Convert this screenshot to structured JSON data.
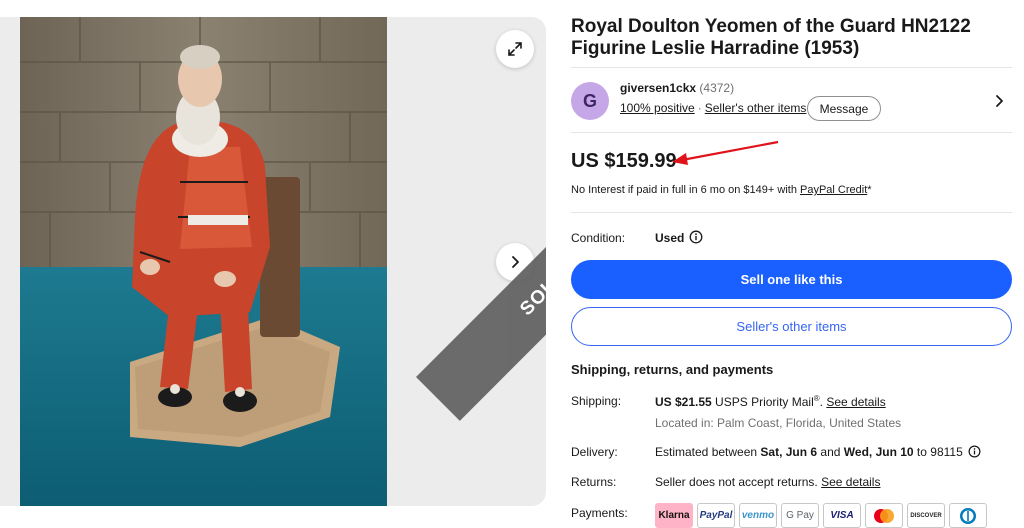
{
  "listing": {
    "title": "Royal Doulton Yeomen of the Guard HN2122 Figurine Leslie Harradine (1953)",
    "sold_label": "SOLD"
  },
  "seller": {
    "avatar_letter": "G",
    "name": "giversen1ckx",
    "feedback_count": "(4372)",
    "positive": "100% positive",
    "separator": "·",
    "other_items_link": "Seller's other items",
    "message_button": "Message"
  },
  "price": {
    "amount": "US $159.99",
    "credit_prefix": "No Interest if paid in full in 6 mo on $149+ with ",
    "credit_link": "PayPal Credit",
    "credit_suffix": "*"
  },
  "condition": {
    "label": "Condition:",
    "value": "Used"
  },
  "buttons": {
    "sell_one": "Sell one like this",
    "other_items": "Seller's other items"
  },
  "shipping": {
    "heading": "Shipping, returns, and payments",
    "shipping_label": "Shipping:",
    "shipping_cost": "US $21.55",
    "shipping_method": " USPS Priority Mail",
    "shipping_reg": "®",
    "shipping_sep": ". ",
    "see_details": "See details",
    "location": "Located in: Palm Coast, Florida, United States",
    "delivery_label": "Delivery:",
    "delivery_prefix": "Estimated between ",
    "delivery_start": "Sat, Jun 6",
    "delivery_and": " and ",
    "delivery_end": "Wed, Jun 10",
    "delivery_suffix": " to 98115",
    "returns_label": "Returns:",
    "returns_text": "Seller does not accept returns. ",
    "returns_link": "See details",
    "payments_label": "Payments:"
  },
  "payments": [
    {
      "name": "Klarna",
      "color": "#ffb3c7",
      "text_color": "#17120f",
      "icon": "klarna-logo"
    },
    {
      "name": "PayPal",
      "color": "#ffffff",
      "text_color": "#253b80",
      "icon": "paypal-logo"
    },
    {
      "name": "venmo",
      "color": "#ffffff",
      "text_color": "#3d95ce",
      "icon": "venmo-logo"
    },
    {
      "name": "G Pay",
      "color": "#ffffff",
      "text_color": "#5f6368",
      "icon": "google-pay-logo"
    },
    {
      "name": "VISA",
      "color": "#ffffff",
      "text_color": "#1a1f71",
      "icon": "visa-logo"
    },
    {
      "name": "",
      "color": "#ffffff",
      "text_color": "#eb001b",
      "icon": "mastercard-logo"
    },
    {
      "name": "DISCOVER",
      "color": "#ffffff",
      "text_color": "#231f20",
      "icon": "discover-logo"
    },
    {
      "name": "",
      "color": "#ffffff",
      "text_color": "#0079be",
      "icon": "diners-club-logo"
    }
  ],
  "colors": {
    "primary_blue": "#1a5fff",
    "link_blue": "#3665f3",
    "arrow_red": "#e0121b",
    "sold_ribbon": "#5f5f5f"
  }
}
